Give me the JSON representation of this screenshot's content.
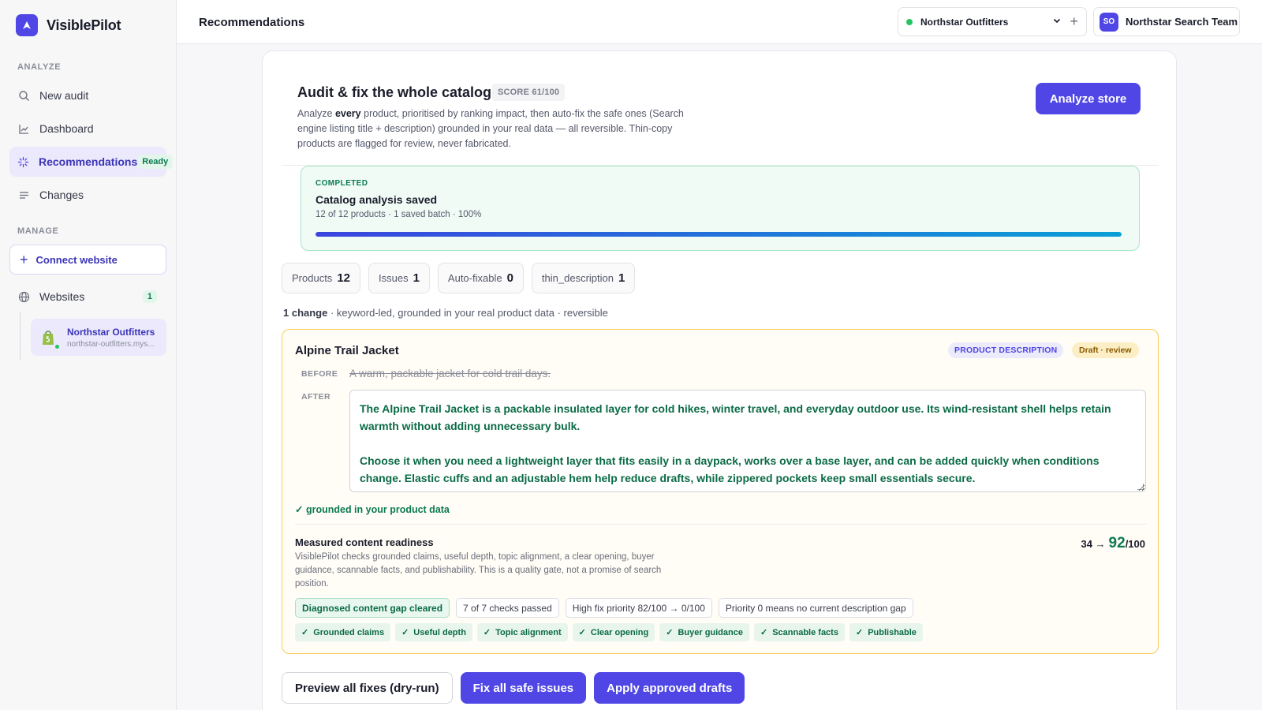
{
  "brand": {
    "name_bold": "Visible",
    "name_rest": "Pilot"
  },
  "sidebar": {
    "analyze_label": "ANALYZE",
    "items": [
      {
        "label": "New audit",
        "icon": "search-icon"
      },
      {
        "label": "Dashboard",
        "icon": "chart-icon"
      },
      {
        "label": "Recommendations",
        "icon": "sparkle-icon",
        "badge": "Ready"
      },
      {
        "label": "Changes",
        "icon": "list-icon"
      }
    ],
    "manage_label": "MANAGE",
    "connect_label": "Connect website",
    "websites_label": "Websites",
    "websites_count": "1",
    "site": {
      "name": "Northstar Outfitters",
      "url": "northstar-outfitters.mys..."
    }
  },
  "topbar": {
    "title": "Recommendations",
    "store": "Northstar Outfitters",
    "team_initials": "SO",
    "team_name": "Northstar Search Team"
  },
  "header": {
    "title": "Audit & fix the whole catalog",
    "score": "SCORE 61/100",
    "desc_pre": "Analyze ",
    "desc_bold": "every",
    "desc_post": " product, prioritised by ranking impact, then auto-fix the safe ones (Search engine listing title + description) grounded in your real data — all reversible. Thin-copy products are flagged for review, never fabricated.",
    "analyze_button": "Analyze store"
  },
  "progress": {
    "label": "COMPLETED",
    "title": "Catalog analysis saved",
    "subtitle": "12 of 12 products · 1 saved batch · 100%",
    "fraction": 1.0
  },
  "stats": [
    {
      "label": "Products",
      "value": "12"
    },
    {
      "label": "Issues",
      "value": "1"
    },
    {
      "label": "Auto-fixable",
      "value": "0"
    },
    {
      "label": "thin_description",
      "value": "1"
    }
  ],
  "change_summary": {
    "bold": "1 change",
    "rest": " · keyword-led, grounded in your real product data · reversible"
  },
  "recommendation": {
    "product": "Alpine Trail Jacket",
    "type_badge": "PRODUCT DESCRIPTION",
    "status_badge": "Draft · review",
    "before_label": "BEFORE",
    "before_text": "A warm, packable jacket for cold trail days.",
    "after_label": "AFTER",
    "after_p1": "The Alpine Trail Jacket is a packable insulated layer for cold hikes, winter travel, and everyday outdoor use. Its wind-resistant shell helps retain warmth without adding unnecessary bulk.",
    "after_p2": "Choose it when you need a lightweight layer that fits easily in a daypack, works over a base layer, and can be added quickly when conditions change. Elastic cuffs and an adjustable hem help reduce drafts, while zippered pockets keep small essentials secure.",
    "grounded_note": "✓ grounded in your product data",
    "readiness_title": "Measured content readiness",
    "readiness_desc": "VisiblePilot checks grounded claims, useful depth, topic alignment, a clear opening, buyer guidance, scannable facts, and publishability. This is a quality gate, not a promise of search position.",
    "score_from": "34 →",
    "score_to": "92",
    "score_den": "/100",
    "pills": [
      "Diagnosed content gap cleared",
      "7 of 7 checks passed",
      "High fix priority 82/100 → 0/100",
      "Priority 0 means no current description gap"
    ],
    "checks": [
      "Grounded claims",
      "Useful depth",
      "Topic alignment",
      "Clear opening",
      "Buyer guidance",
      "Scannable facts",
      "Publishable"
    ]
  },
  "actions": {
    "preview": "Preview all fixes (dry-run)",
    "fix_safe": "Fix all safe issues",
    "apply": "Apply approved drafts"
  },
  "colors": {
    "accent": "#4f46e5",
    "success": "#0d7a52",
    "warning_border": "#f4cf5a"
  }
}
